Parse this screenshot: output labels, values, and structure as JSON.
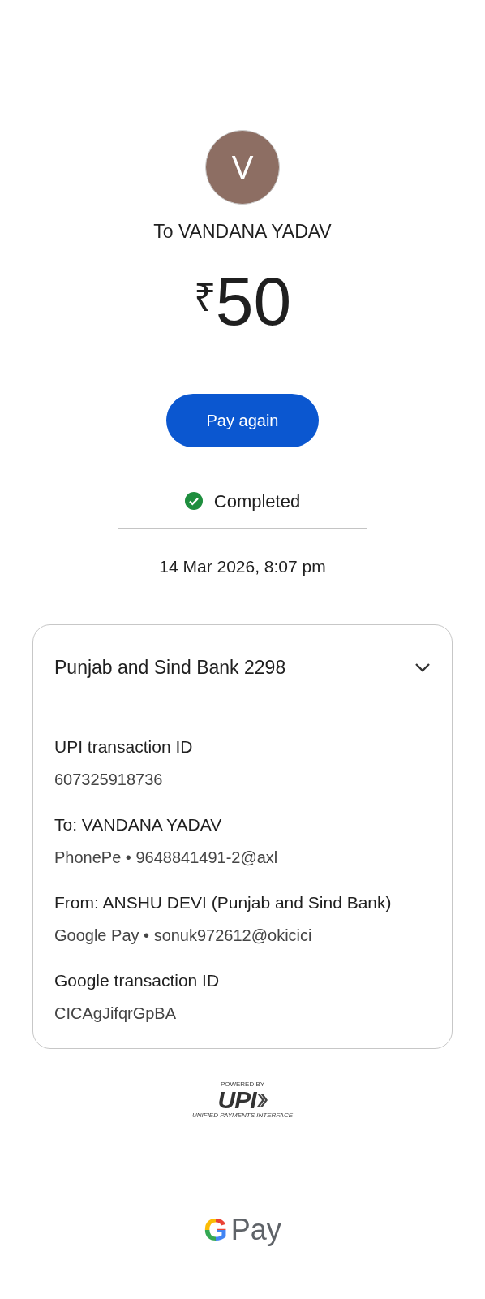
{
  "recipient": {
    "initial": "V",
    "label": "To VANDANA YADAV"
  },
  "amount": {
    "currency": "₹",
    "value": "50"
  },
  "pay_again_button": "Pay again",
  "status": {
    "label": "Completed",
    "completed": true
  },
  "datetime": "14 Mar 2026, 8:07 pm",
  "details_card": {
    "title": "Punjab and Sind Bank 2298",
    "expanded": true,
    "rows": [
      {
        "label": "UPI transaction ID",
        "value": "607325918736"
      },
      {
        "label": "To: VANDANA YADAV",
        "value": "PhonePe • 9648841491-2@axl"
      },
      {
        "label": "From: ANSHU DEVI (Punjab and Sind Bank)",
        "value": "Google Pay • sonuk972612@okicici"
      },
      {
        "label": "Google transaction ID",
        "value": "CICAgJifqrGpBA"
      }
    ]
  },
  "upi_logo": {
    "top": "POWERED BY",
    "mark": "UPI",
    "bottom": "UNIFIED PAYMENTS INTERFACE"
  },
  "footer_brand": {
    "g": "G",
    "text": "Pay"
  }
}
